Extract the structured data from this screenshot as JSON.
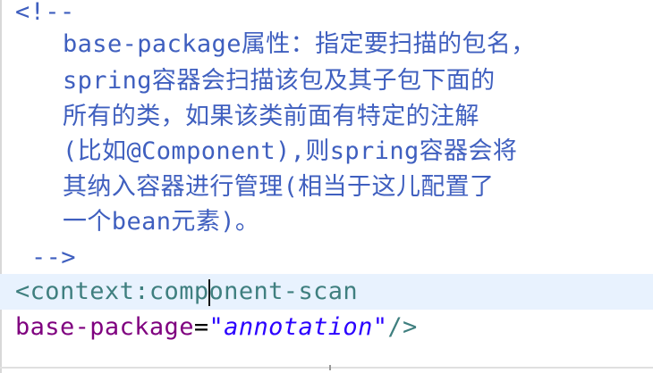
{
  "editor": {
    "comment_open": "<!--",
    "comment_lines": [
      "base-package属性：指定要扫描的包名，",
      "spring容器会扫描该包及其子包下面的",
      "所有的类，如果该类前面有特定的注解",
      "(比如@Component),则spring容器会将",
      "其纳入容器进行管理(相当于这儿配置了",
      "一个bean元素)。"
    ],
    "comment_close": "-->",
    "tag_line": {
      "before_caret": "<context:comp",
      "after_caret": "onent-scan"
    },
    "attr_line": {
      "attr_name": "base-package",
      "equals": "=",
      "value": "\"annotation\"",
      "tag_end": "/>"
    }
  }
}
